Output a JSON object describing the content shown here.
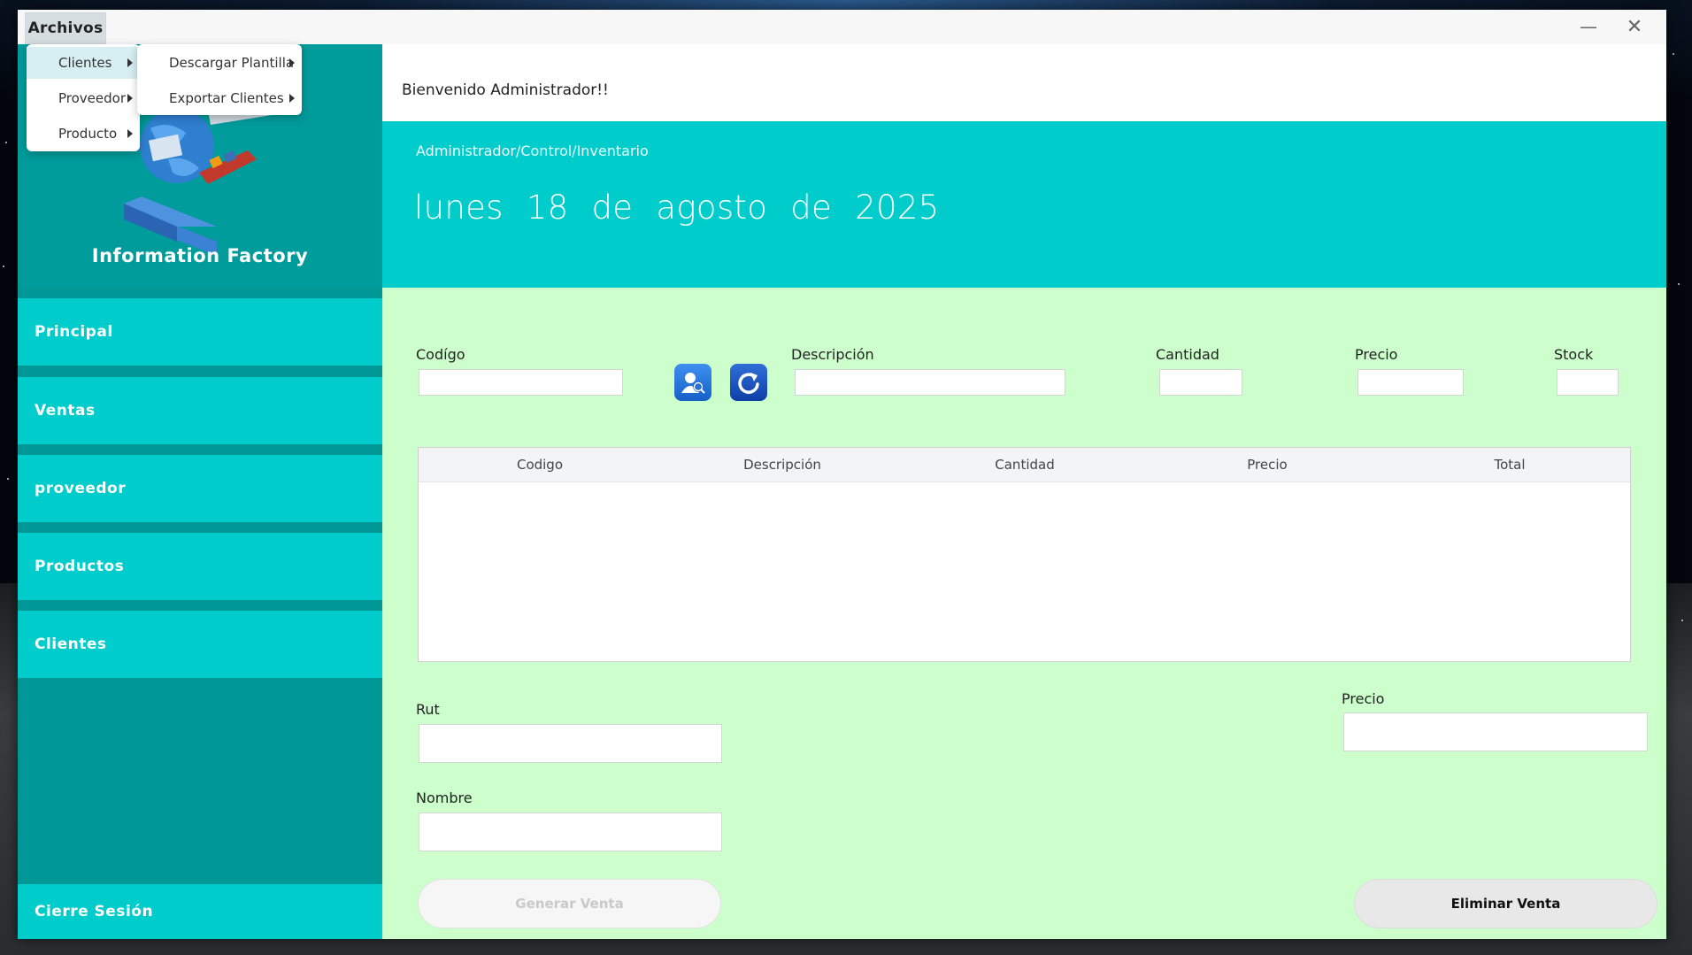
{
  "menubar": {
    "archivos": "Archivos"
  },
  "archivos_menu": [
    {
      "label": "Clientes"
    },
    {
      "label": "Proveedor"
    },
    {
      "label": "Producto"
    }
  ],
  "clientes_submenu": [
    {
      "label": "Descargar Plantilla"
    },
    {
      "label": "Exportar Clientes"
    }
  ],
  "sidebar": {
    "brand": "Information Factory",
    "items": [
      {
        "label": "Principal"
      },
      {
        "label": "Ventas"
      },
      {
        "label": "proveedor"
      },
      {
        "label": "Productos"
      },
      {
        "label": "Clientes"
      }
    ],
    "logout": "Cierre Sesión"
  },
  "header": {
    "welcome": "Bienvenido Administrador!!",
    "breadcrumb": "Administrador/Control/Inventario",
    "date": "lunes 18  de  agosto  de  2025"
  },
  "form": {
    "codigo_label": "Codígo",
    "descripcion_label": "Descripción",
    "cantidad_label": "Cantidad",
    "precio_label": "Precio",
    "stock_label": "Stock",
    "codigo": "",
    "descripcion": "",
    "cantidad": "",
    "precio": "",
    "stock": ""
  },
  "table": {
    "columns": [
      "Codigo",
      "Descripción",
      "Cantidad",
      "Precio",
      "Total"
    ],
    "rows": []
  },
  "footer_form": {
    "rut_label": "Rut",
    "nombre_label": "Nombre",
    "precio_label": "Precio",
    "rut": "",
    "nombre": "",
    "precio": ""
  },
  "buttons": {
    "generar": "Generar Venta",
    "eliminar": "Eliminar Venta"
  },
  "icons": {
    "search_user": "user-search-icon",
    "refresh": "refresh-icon",
    "minimize": "minimize-icon",
    "close": "close-icon"
  },
  "colors": {
    "teal_dark": "#009797",
    "teal": "#00cccc",
    "mint_bg": "#ccffcc",
    "icon_blue": "#1f6fd8"
  }
}
